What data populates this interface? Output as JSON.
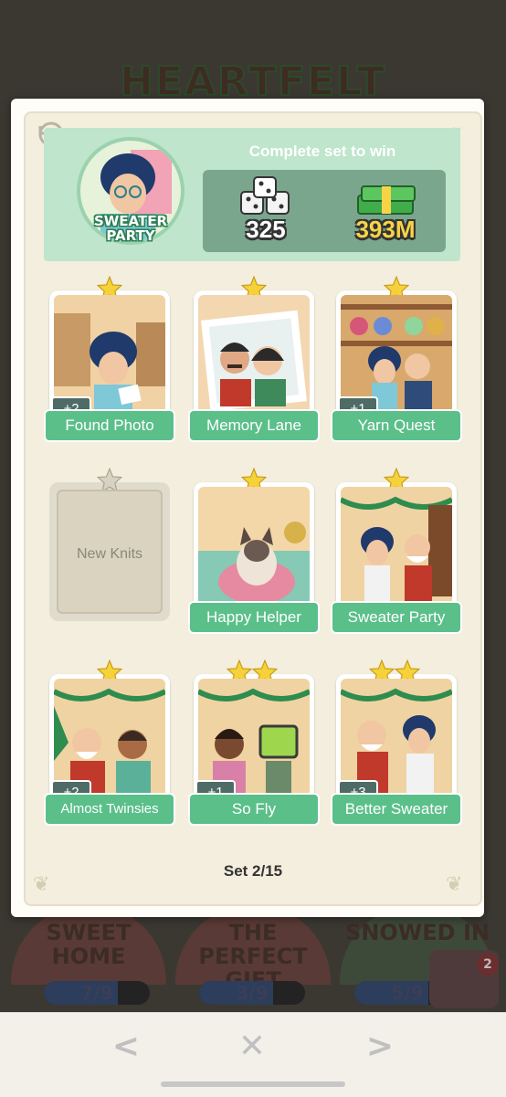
{
  "background": {
    "album_title": "HEARTFELT",
    "sets": [
      {
        "name": "SWEET HOME",
        "progress": "7/9"
      },
      {
        "name": "THE PERFECT GIFT",
        "progress": "3/9"
      },
      {
        "name": "SNOWED IN",
        "progress": "5/9"
      }
    ],
    "notification_count": "2"
  },
  "modal": {
    "set_name": "SWEATER PARTY",
    "complete_text": "Complete set to win",
    "reward_dice": "325",
    "reward_cash": "393M",
    "set_count": "Set 2/15",
    "cards": [
      {
        "name": "Found Photo",
        "stars": 1,
        "count": "+2",
        "collected": true
      },
      {
        "name": "Memory Lane",
        "stars": 1,
        "count": "",
        "collected": true
      },
      {
        "name": "Yarn Quest",
        "stars": 1,
        "count": "+1",
        "collected": true
      },
      {
        "name": "New Knits",
        "stars": 1,
        "count": "",
        "collected": false
      },
      {
        "name": "Happy Helper",
        "stars": 1,
        "count": "",
        "collected": true
      },
      {
        "name": "Sweater Party",
        "stars": 1,
        "count": "",
        "collected": true
      },
      {
        "name": "Almost Twinsies",
        "stars": 1,
        "count": "+2",
        "collected": true
      },
      {
        "name": "So Fly",
        "stars": 2,
        "count": "+1",
        "collected": true
      },
      {
        "name": "Better Sweater",
        "stars": 2,
        "count": "+3",
        "collected": true
      }
    ]
  },
  "nav": {
    "prev_label": "<",
    "close_label": "✕",
    "next_label": ">"
  },
  "colors": {
    "label_green": "#5bbf8a",
    "header_green": "#bfe5cc",
    "reward_box": "#7aa68e",
    "star_gold": "#f6d23a",
    "cash_yellow": "#f7d447"
  }
}
